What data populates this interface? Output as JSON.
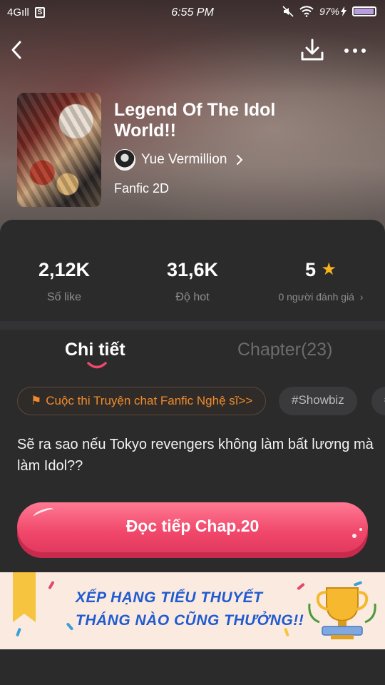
{
  "status_bar": {
    "network": "4G",
    "signal": "ıll",
    "sim_icon": "S",
    "time": "6:55 PM",
    "battery_percent": "97%"
  },
  "nav": {
    "back_icon": "chevron-left-icon",
    "download_icon": "download-icon",
    "more_icon": "more-horizontal-icon"
  },
  "story": {
    "title": "Legend Of The Idol World!!",
    "author": "Yue Vermillion",
    "genre": "Fanfic 2D"
  },
  "stats": {
    "likes_value": "2,12K",
    "likes_label": "Số like",
    "hot_value": "31,6K",
    "hot_label": "Độ hot",
    "rating_value": "5",
    "rating_label": "0 người đánh giá"
  },
  "tabs": {
    "details": "Chi tiết",
    "chapters": "Chapter(23)"
  },
  "tags": {
    "contest": "Cuộc thi Truyện chat Fanfic Nghệ sĩ>>",
    "tag2": "#Showbiz",
    "tag3": "#"
  },
  "description": "Sẽ ra sao nếu Tokyo revengers không làm bất lương mà làm Idol??",
  "read_button": "Đọc tiếp Chap.20",
  "banner": {
    "line1": "XẾP HẠNG TIỂU THUYẾT",
    "line2": "THÁNG NÀO CŨNG THƯỞNG!!"
  },
  "colors": {
    "accent": "#f0476a",
    "contest_orange": "#f08b2d",
    "star": "#f6b31b",
    "panel": "#2b2b2c",
    "banner_text": "#1f5bd1"
  }
}
